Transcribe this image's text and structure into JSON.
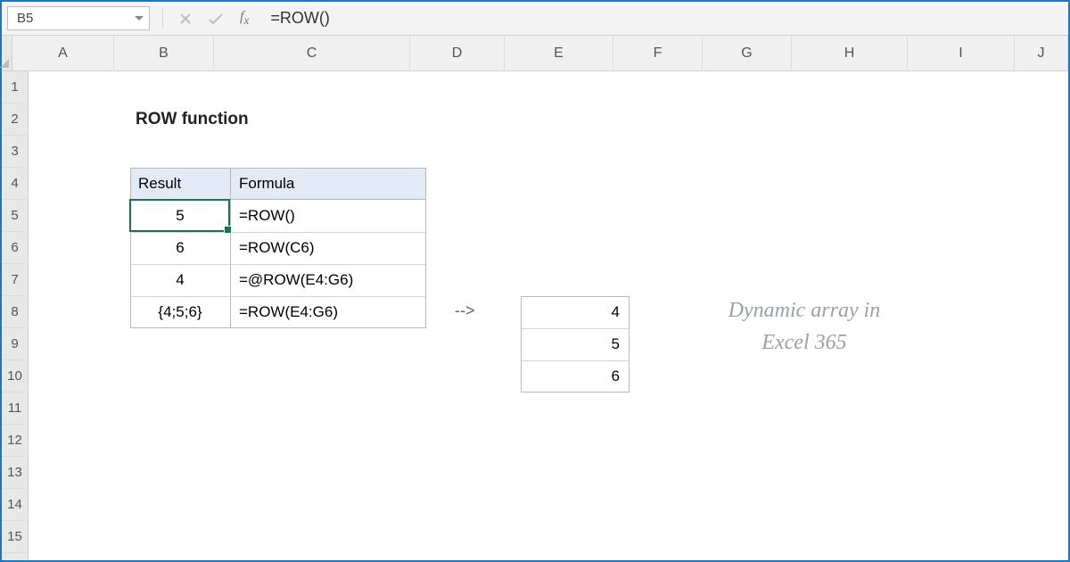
{
  "name_box": "B5",
  "formula_bar": "=ROW()",
  "columns": [
    "A",
    "B",
    "C",
    "D",
    "E",
    "F",
    "G",
    "H",
    "I",
    "J"
  ],
  "rows": [
    "1",
    "2",
    "3",
    "4",
    "5",
    "6",
    "7",
    "8",
    "9",
    "10",
    "11",
    "12",
    "13",
    "14",
    "15"
  ],
  "title": "ROW function",
  "table": {
    "headers": {
      "result": "Result",
      "formula": "Formula"
    },
    "rows": [
      {
        "result": "5",
        "formula": "=ROW()"
      },
      {
        "result": "6",
        "formula": "=ROW(C6)"
      },
      {
        "result": "4",
        "formula": "=@ROW(E4:G6)"
      },
      {
        "result": "{4;5;6}",
        "formula": "=ROW(E4:G6)"
      }
    ]
  },
  "arrow": "-->",
  "spill": [
    "4",
    "5",
    "6"
  ],
  "annotation": "Dynamic array in\nExcel 365"
}
